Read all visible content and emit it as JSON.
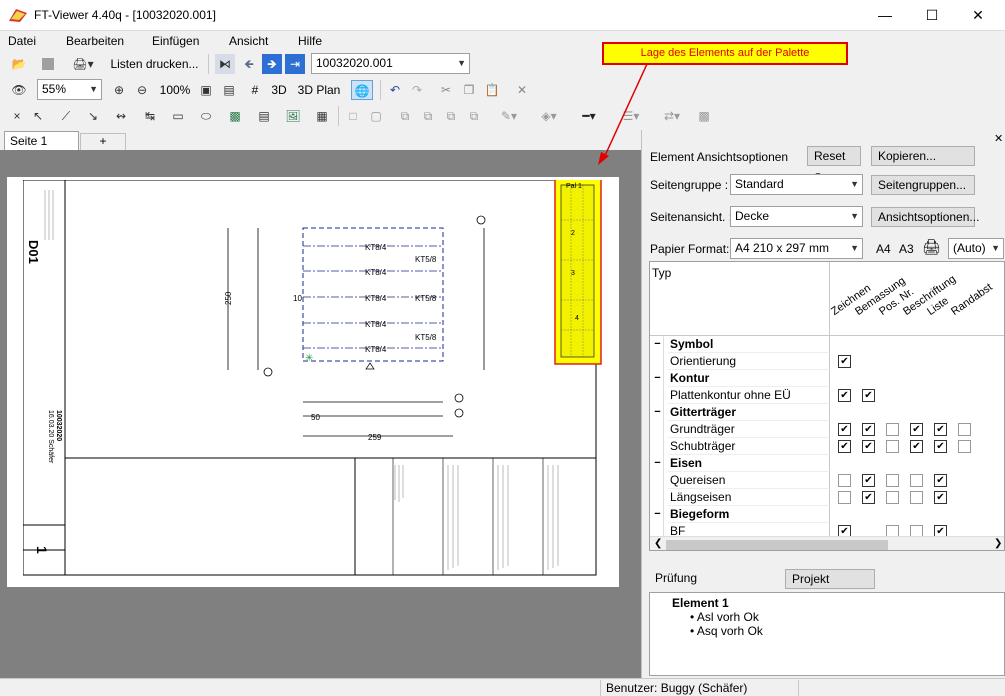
{
  "window": {
    "title": "FT-Viewer 4.40q - [10032020.001]"
  },
  "menu": [
    "Datei",
    "Bearbeiten",
    "Einfügen",
    "Ansicht",
    "Hilfe"
  ],
  "toolbar1": {
    "print_list_label": "Listen drucken...",
    "file_value": "10032020.001"
  },
  "toolbar2": {
    "zoom_value": "55%",
    "zoom100_label": "100%",
    "hash_label": "#",
    "three_d_label": "3D",
    "three_d_plan_label": "3D Plan"
  },
  "tabs": {
    "page1": "Seite 1",
    "add": "+"
  },
  "callout": {
    "text": "Lage des Elements auf der Palette"
  },
  "panel": {
    "view_options_label": "Element Ansichtsoptionen",
    "reset_label": "Reset",
    "copy_label": "Kopieren...",
    "page_group_label": "Seitengruppe :",
    "page_group_value": "Standard",
    "page_groups_btn": "Seitengruppen...",
    "page_view_label": "Seitenansicht. :",
    "page_view_value": "Decke",
    "view_options_btn": "Ansichtsoptionen...",
    "paper_format_label": "Papier Format:",
    "paper_format_value": "A4 210 x 297 mm",
    "a4": "A4",
    "a3": "A3",
    "auto_value": "(Auto)",
    "type_header": "Typ",
    "columns": [
      "Zeichnen",
      "Bemassung",
      "Pos. Nr.",
      "Beschriftung",
      "Liste",
      "Randabst"
    ],
    "rows": [
      {
        "name": "Symbol",
        "group": true,
        "checks": []
      },
      {
        "name": "Orientierung",
        "group": false,
        "checks": [
          1,
          null,
          null,
          null,
          null,
          null
        ]
      },
      {
        "name": "Kontur",
        "group": true,
        "checks": []
      },
      {
        "name": "Plattenkontur ohne EÜ",
        "group": false,
        "checks": [
          1,
          1,
          null,
          null,
          null,
          null
        ]
      },
      {
        "name": "Gitterträger",
        "group": true,
        "checks": []
      },
      {
        "name": "Grundträger",
        "group": false,
        "checks": [
          1,
          1,
          0,
          1,
          1,
          0
        ]
      },
      {
        "name": "Schubträger",
        "group": false,
        "checks": [
          1,
          1,
          0,
          1,
          1,
          0
        ]
      },
      {
        "name": "Eisen",
        "group": true,
        "checks": []
      },
      {
        "name": "Quereisen",
        "group": false,
        "checks": [
          0,
          1,
          0,
          0,
          1,
          null
        ]
      },
      {
        "name": "Längseisen",
        "group": false,
        "checks": [
          0,
          1,
          0,
          0,
          1,
          null
        ]
      },
      {
        "name": "Biegeform",
        "group": true,
        "checks": []
      },
      {
        "name": "BF",
        "group": false,
        "checks": [
          1,
          null,
          0,
          0,
          1,
          null
        ]
      }
    ],
    "check_label": "Prüfung",
    "project_check_btn": "Projekt Prüfung",
    "result_title": "Element 1",
    "result_items": [
      "Asl vorh Ok",
      "Asq vorh Ok"
    ]
  },
  "status": {
    "user": "Benutzer: Buggy (Schäfer)"
  },
  "drawing": {
    "element_code": "D01",
    "project": "10032020",
    "date": "16.03.20 Schäfer",
    "kt_labels": [
      "KT8/4",
      "KT8/4",
      "KT8/4",
      "KT8/4",
      "KT8/4"
    ],
    "kt16_labels": [
      "KT5/8",
      "KT5/8",
      "KT5/8"
    ],
    "dim_250": "250",
    "dim_259": "259",
    "dim_50": "50",
    "dim_10": "10",
    "pal_label": "Pal 1",
    "sheet_num": "1",
    "mini_nums": [
      "2",
      "3",
      "4"
    ]
  }
}
